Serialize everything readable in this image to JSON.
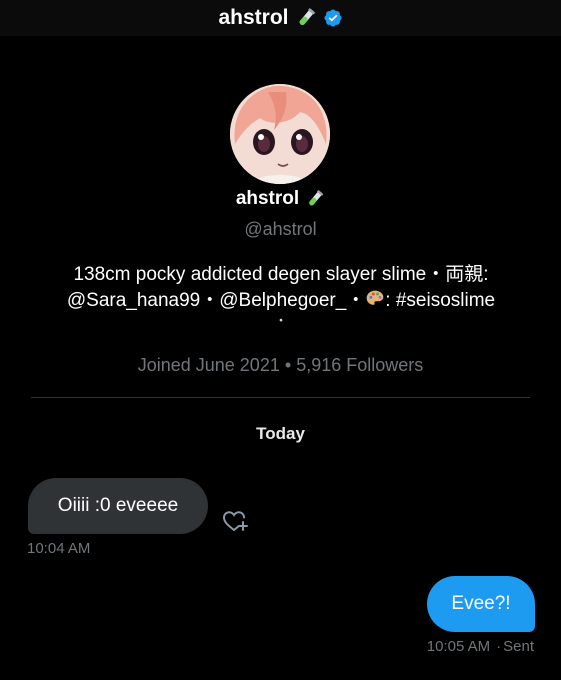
{
  "header": {
    "title": "ahstrol",
    "title_emoji": "test-tube-icon",
    "verified_icon": "verified-badge-icon",
    "accent": "#1d9bf0"
  },
  "profile": {
    "display_name": "ahstrol",
    "handle": "@ahstrol",
    "bio_line1": "138cm pocky addicted degen slayer slime・両親:",
    "bio_line2_part1": "@Sara_hana99・@Belphegoer_・",
    "bio_line2_part2": ": #seisoslime",
    "bio_line3": "・",
    "joined": "Joined June 2021",
    "separator": "•",
    "followers": "5,916 Followers"
  },
  "conversation": {
    "day_label": "Today",
    "messages": [
      {
        "direction": "received",
        "text": "Oiiii :0 eveeee",
        "time": "10:04 AM",
        "bubble_color": "#2f3336"
      },
      {
        "direction": "sent",
        "text": "Evee?!",
        "time": "10:05 AM",
        "dot": "·",
        "status": "Sent",
        "bubble_color": "#1d9bf0"
      }
    ]
  }
}
